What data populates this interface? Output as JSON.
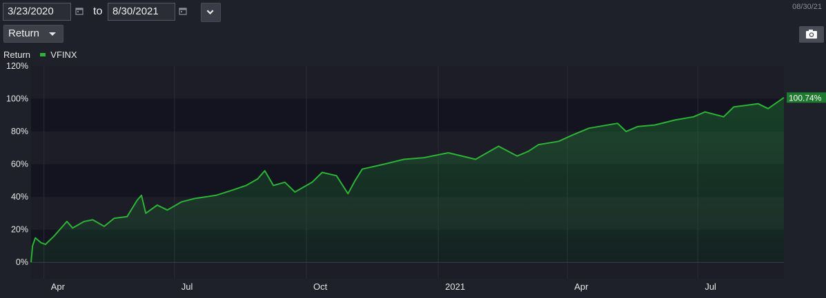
{
  "toolbar": {
    "start_date": "3/23/2020",
    "to_label": "to",
    "end_date": "8/30/2021",
    "top_right_date": "08/30/21"
  },
  "controls": {
    "metric_select": "Return"
  },
  "icons": {
    "start_calendar": "calendar-icon",
    "end_calendar": "calendar-icon",
    "dropdown": "chevron-down-icon",
    "camera": "camera-icon"
  },
  "colors": {
    "line": "#2db336",
    "badge": "#1e7a2e",
    "background": "#1f212a",
    "plot_band_dark": "#13141f",
    "plot_band_light": "#1c1d27"
  },
  "chart_data": {
    "type": "area",
    "legend_title": "Return",
    "legend_position": "top-left",
    "series": [
      {
        "name": "VFINX",
        "color": "#2db336",
        "last_value_label": "100.74%",
        "points": [
          [
            "2020-03-23",
            0
          ],
          [
            "2020-03-24",
            10
          ],
          [
            "2020-03-26",
            15
          ],
          [
            "2020-03-30",
            12
          ],
          [
            "2020-04-02",
            11
          ],
          [
            "2020-04-08",
            16
          ],
          [
            "2020-04-14",
            22
          ],
          [
            "2020-04-17",
            25
          ],
          [
            "2020-04-21",
            21
          ],
          [
            "2020-04-29",
            25
          ],
          [
            "2020-05-05",
            26
          ],
          [
            "2020-05-13",
            22
          ],
          [
            "2020-05-20",
            27
          ],
          [
            "2020-05-29",
            28
          ],
          [
            "2020-06-05",
            38
          ],
          [
            "2020-06-08",
            41
          ],
          [
            "2020-06-11",
            30
          ],
          [
            "2020-06-19",
            35
          ],
          [
            "2020-06-26",
            32
          ],
          [
            "2020-07-06",
            37
          ],
          [
            "2020-07-15",
            39
          ],
          [
            "2020-07-30",
            41
          ],
          [
            "2020-08-10",
            44
          ],
          [
            "2020-08-20",
            47
          ],
          [
            "2020-08-28",
            51
          ],
          [
            "2020-09-02",
            56
          ],
          [
            "2020-09-08",
            47
          ],
          [
            "2020-09-16",
            49
          ],
          [
            "2020-09-23",
            43
          ],
          [
            "2020-10-05",
            49
          ],
          [
            "2020-10-12",
            55
          ],
          [
            "2020-10-22",
            53
          ],
          [
            "2020-10-30",
            42
          ],
          [
            "2020-11-04",
            50
          ],
          [
            "2020-11-09",
            57
          ],
          [
            "2020-11-24",
            60
          ],
          [
            "2020-12-08",
            63
          ],
          [
            "2020-12-22",
            64
          ],
          [
            "2021-01-08",
            67
          ],
          [
            "2021-01-27",
            63
          ],
          [
            "2021-02-08",
            69
          ],
          [
            "2021-02-12",
            71
          ],
          [
            "2021-02-25",
            65
          ],
          [
            "2021-03-05",
            68
          ],
          [
            "2021-03-12",
            72
          ],
          [
            "2021-03-26",
            74
          ],
          [
            "2021-04-05",
            78
          ],
          [
            "2021-04-16",
            82
          ],
          [
            "2021-05-06",
            85
          ],
          [
            "2021-05-12",
            80
          ],
          [
            "2021-05-20",
            83
          ],
          [
            "2021-06-01",
            84
          ],
          [
            "2021-06-15",
            87
          ],
          [
            "2021-06-28",
            89
          ],
          [
            "2021-07-06",
            92
          ],
          [
            "2021-07-19",
            89
          ],
          [
            "2021-07-26",
            95
          ],
          [
            "2021-08-12",
            97
          ],
          [
            "2021-08-19",
            94
          ],
          [
            "2021-08-30",
            100.74
          ]
        ]
      }
    ],
    "xlim": [
      "2020-03-23",
      "2021-08-30"
    ],
    "ylim": [
      -10,
      120
    ],
    "y_ticks": [
      0,
      20,
      40,
      60,
      80,
      100,
      120
    ],
    "y_tick_labels": [
      "0%",
      "20%",
      "40%",
      "60%",
      "80%",
      "100%",
      "120%"
    ],
    "x_ticks": [
      "2020-04-01",
      "2020-07-01",
      "2020-10-01",
      "2021-01-01",
      "2021-04-01",
      "2021-07-01"
    ],
    "x_tick_labels": [
      "Apr",
      "Jul",
      "Oct",
      "2021",
      "Apr",
      "Jul"
    ],
    "grid": true
  }
}
